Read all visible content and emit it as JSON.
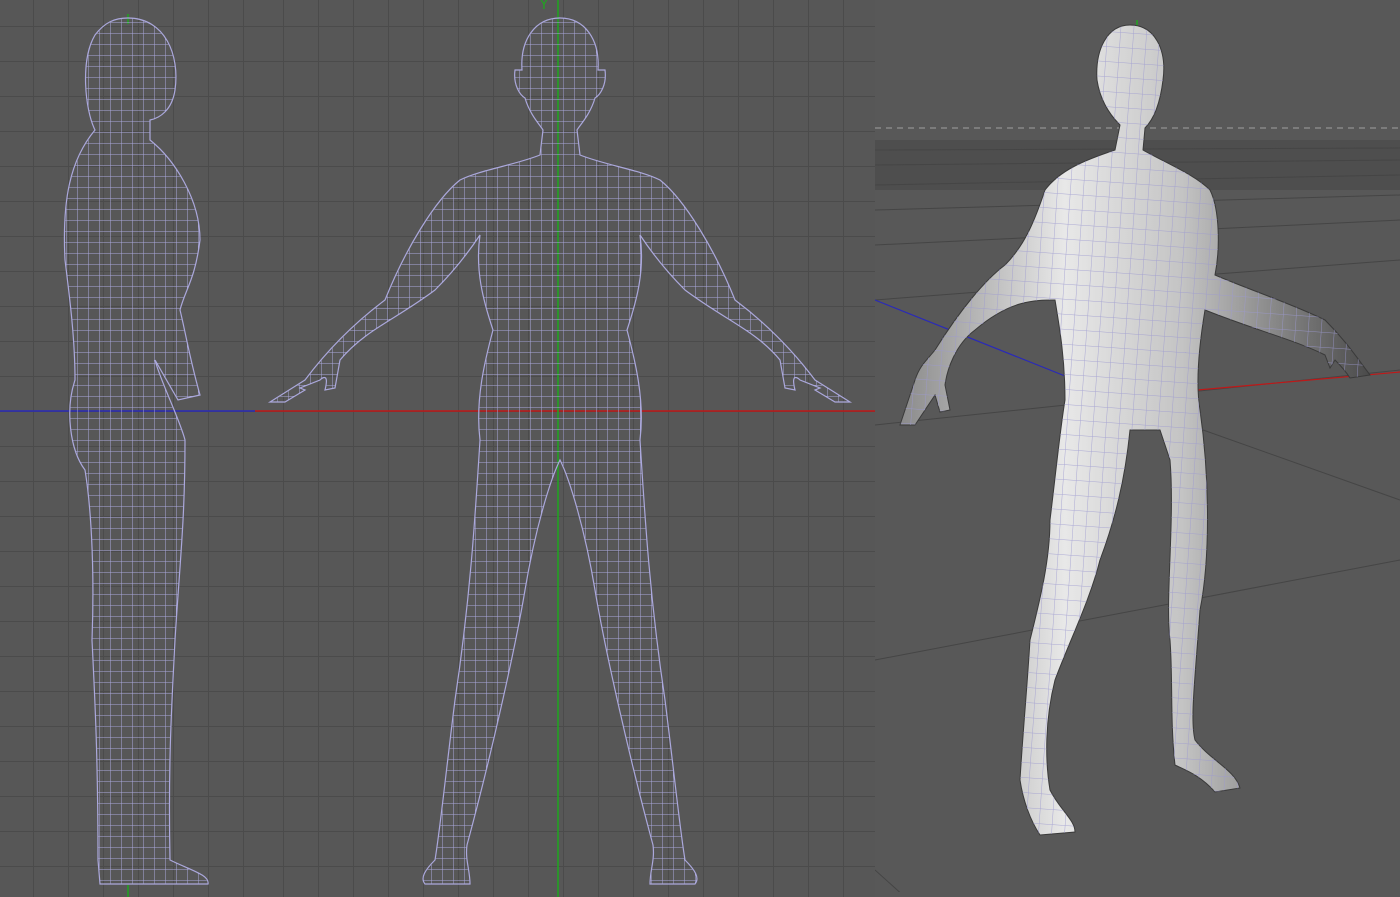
{
  "scene": {
    "axis_label_y": "Y",
    "viewports": [
      {
        "id": "side",
        "view": "side-orthographic",
        "display": "wireframe"
      },
      {
        "id": "front",
        "view": "front-orthographic",
        "display": "wireframe"
      },
      {
        "id": "perspective",
        "view": "perspective",
        "display": "shaded-wireframe"
      }
    ]
  },
  "colors": {
    "background": "#575757",
    "grid": "#4b4b4b",
    "wire": "#aba8dc",
    "x_axis": "#c01818",
    "y_axis": "#1fa61f",
    "z_axis": "#2a2ab8"
  }
}
